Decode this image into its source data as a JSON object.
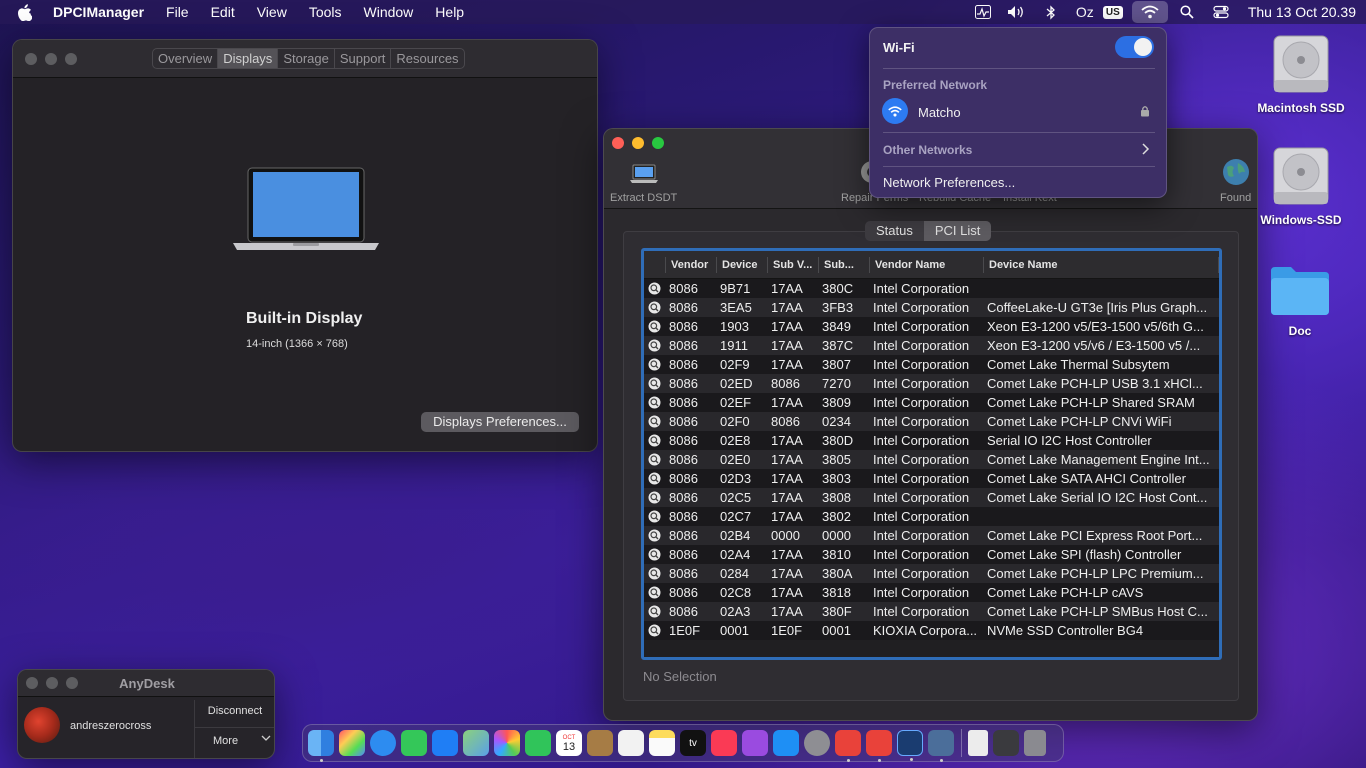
{
  "menubar": {
    "app_name": "DPCIManager",
    "items": [
      "File",
      "Edit",
      "View",
      "Tools",
      "Window",
      "Help"
    ],
    "status_text": "Oz",
    "input_badge": "US",
    "clock": "Thu 13 Oct  20.39",
    "icons": [
      "activity-monitor-icon",
      "volume-icon",
      "bluetooth-icon",
      "wifi-icon",
      "spotlight-icon",
      "control-center-icon"
    ]
  },
  "about_window": {
    "tabs": [
      "Overview",
      "Displays",
      "Storage",
      "Support",
      "Resources"
    ],
    "selected_tab": "Displays",
    "display_title": "Built-in Display",
    "display_subtitle": "14-inch (1366 × 768)",
    "prefs_button": "Displays Preferences..."
  },
  "dpci_window": {
    "toolbar": {
      "extract": "Extract DSDT",
      "repair": "Repair Perms",
      "rebuild": "Rebuild Cache",
      "install": "Install Kext",
      "found": "Found"
    },
    "tabs": [
      "Status",
      "PCI List"
    ],
    "selected_tab": "PCI List",
    "columns": [
      "Vendor",
      "Device",
      "Sub V...",
      "Sub...",
      "Vendor Name",
      "Device Name"
    ],
    "rows": [
      [
        "8086",
        "9B71",
        "17AA",
        "380C",
        "Intel Corporation",
        ""
      ],
      [
        "8086",
        "3EA5",
        "17AA",
        "3FB3",
        "Intel Corporation",
        "CoffeeLake-U GT3e [Iris Plus Graph..."
      ],
      [
        "8086",
        "1903",
        "17AA",
        "3849",
        "Intel Corporation",
        "Xeon E3-1200 v5/E3-1500 v5/6th G..."
      ],
      [
        "8086",
        "1911",
        "17AA",
        "387C",
        "Intel Corporation",
        "Xeon E3-1200 v5/v6 / E3-1500 v5 /..."
      ],
      [
        "8086",
        "02F9",
        "17AA",
        "3807",
        "Intel Corporation",
        "Comet Lake Thermal Subsytem"
      ],
      [
        "8086",
        "02ED",
        "8086",
        "7270",
        "Intel Corporation",
        "Comet Lake PCH-LP USB 3.1 xHCl..."
      ],
      [
        "8086",
        "02EF",
        "17AA",
        "3809",
        "Intel Corporation",
        "Comet Lake PCH-LP Shared SRAM"
      ],
      [
        "8086",
        "02F0",
        "8086",
        "0234",
        "Intel Corporation",
        "Comet Lake PCH-LP CNVi WiFi"
      ],
      [
        "8086",
        "02E8",
        "17AA",
        "380D",
        "Intel Corporation",
        "Serial IO I2C Host Controller"
      ],
      [
        "8086",
        "02E0",
        "17AA",
        "3805",
        "Intel Corporation",
        "Comet Lake Management Engine Int..."
      ],
      [
        "8086",
        "02D3",
        "17AA",
        "3803",
        "Intel Corporation",
        "Comet Lake SATA AHCI Controller"
      ],
      [
        "8086",
        "02C5",
        "17AA",
        "3808",
        "Intel Corporation",
        "Comet Lake Serial IO I2C Host Cont..."
      ],
      [
        "8086",
        "02C7",
        "17AA",
        "3802",
        "Intel Corporation",
        ""
      ],
      [
        "8086",
        "02B4",
        "0000",
        "0000",
        "Intel Corporation",
        "Comet Lake PCI Express Root Port..."
      ],
      [
        "8086",
        "02A4",
        "17AA",
        "3810",
        "Intel Corporation",
        "Comet Lake SPI (flash) Controller"
      ],
      [
        "8086",
        "0284",
        "17AA",
        "380A",
        "Intel Corporation",
        "Comet Lake PCH-LP LPC Premium..."
      ],
      [
        "8086",
        "02C8",
        "17AA",
        "3818",
        "Intel Corporation",
        "Comet Lake PCH-LP cAVS"
      ],
      [
        "8086",
        "02A3",
        "17AA",
        "380F",
        "Intel Corporation",
        "Comet Lake PCH-LP SMBus Host C..."
      ],
      [
        "1E0F",
        "0001",
        "1E0F",
        "0001",
        "KIOXIA Corpora...",
        "NVMe SSD Controller BG4"
      ]
    ],
    "status": "No Selection"
  },
  "wifi_menu": {
    "title": "Wi-Fi",
    "enabled": true,
    "preferred_label": "Preferred Network",
    "network": "Matcho",
    "other_label": "Other Networks",
    "prefs": "Network Preferences..."
  },
  "desktop": {
    "icons": [
      "Macintosh SSD",
      "Windows-SSD",
      "Doc"
    ]
  },
  "anydesk": {
    "title": "AnyDesk",
    "user": "andreszerocross",
    "disconnect": "Disconnect",
    "more": "More"
  },
  "dock": {
    "calendar_month": "OCT",
    "calendar_day": "13",
    "tv_label": "tv"
  },
  "colors": {
    "accent_blue": "#2f6db8",
    "toggle_on": "#2c6fe3",
    "traffic_red": "#fe5f57",
    "traffic_yellow": "#febc2e",
    "traffic_green": "#28c840"
  }
}
